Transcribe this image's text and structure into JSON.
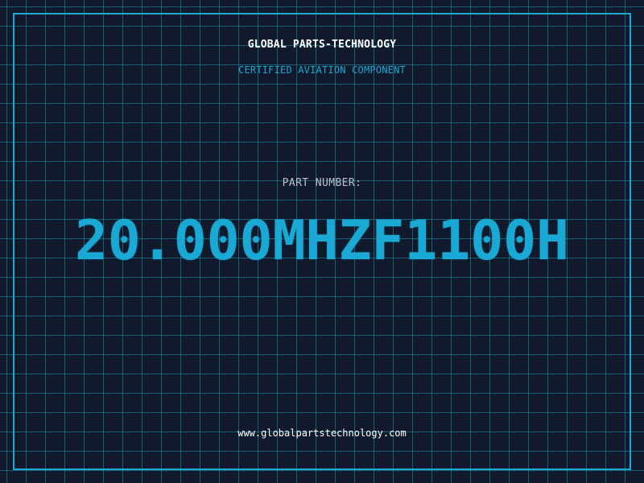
{
  "header": {
    "brand": "GLOBAL PARTS-TECHNOLOGY",
    "subtitle": "CERTIFIED AVIATION COMPONENT"
  },
  "main": {
    "part_label": "PART NUMBER:",
    "part_number": "20.000MHZF1100H"
  },
  "footer": {
    "website": "www.globalpartstechnology.com"
  },
  "colors": {
    "background": "#111a2c",
    "accent": "#1aa8d4",
    "grid": "#2296aa",
    "text": "#ffffff",
    "label": "#b9c0cc"
  }
}
